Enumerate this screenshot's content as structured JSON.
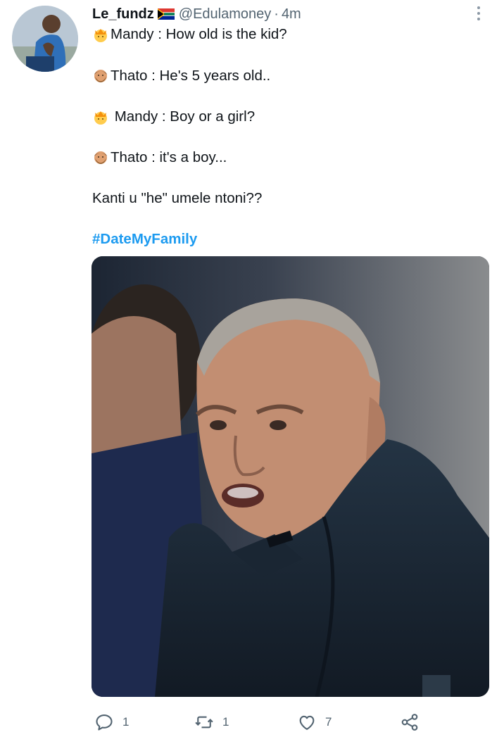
{
  "tweet": {
    "display_name": "Le_fundz",
    "flag_icon": "south-africa-flag-icon",
    "handle": "@Edulamoney",
    "separator": "·",
    "time": "4m",
    "lines": [
      {
        "emoji": "princess-emoji",
        "text": "Mandy : How old is the kid?"
      },
      {
        "emoji": "man-bearded-emoji",
        "text": "Thato : He's 5 years old.."
      },
      {
        "emoji": "princess-emoji",
        "text": " Mandy : Boy or a girl?"
      },
      {
        "emoji": "man-bearded-emoji",
        "text": "Thato : it's a boy..."
      },
      {
        "emoji": "",
        "text": "Kanti u \"he\" umele ntoni??"
      }
    ],
    "hashtag": "#DateMyFamily",
    "media_icon": "photo-of-man-in-dark-jacket"
  },
  "actions": {
    "reply_count": "1",
    "retweet_count": "1",
    "like_count": "7"
  },
  "colors": {
    "link": "#1d9bf0",
    "secondary_text": "#536471",
    "icon": "#536471"
  }
}
